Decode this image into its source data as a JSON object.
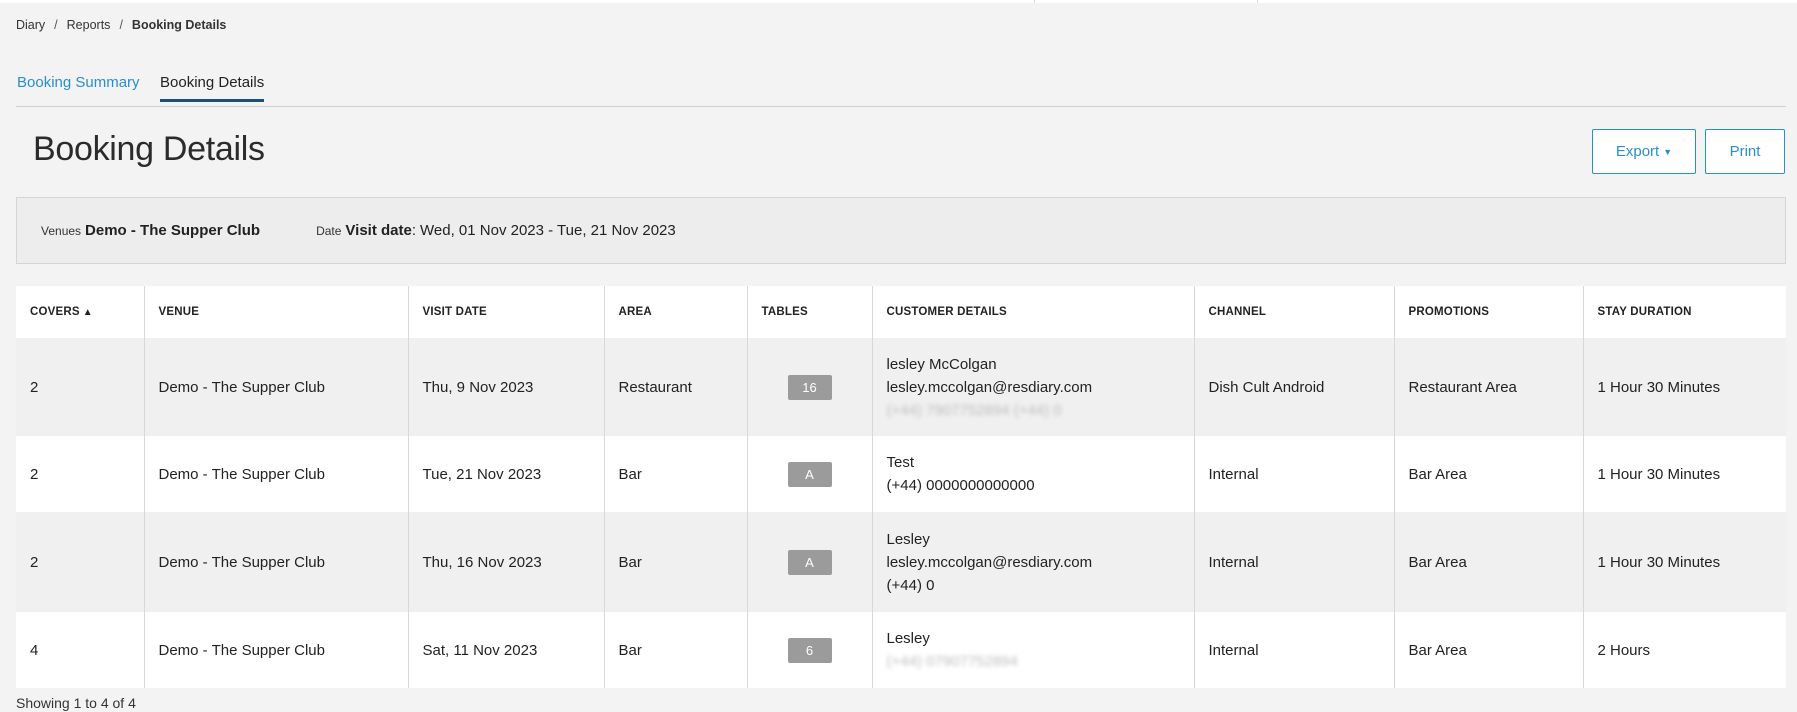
{
  "breadcrumb": {
    "items": [
      "Diary",
      "Reports"
    ],
    "current": "Booking Details",
    "separator": "/"
  },
  "tabs": [
    {
      "label": "Booking Summary",
      "active": false
    },
    {
      "label": "Booking Details",
      "active": true
    }
  ],
  "page": {
    "title": "Booking Details"
  },
  "actions": {
    "export_label": "Export",
    "print_label": "Print"
  },
  "filters": {
    "venues_label": "Venues",
    "venues_value": "Demo - The Supper Club",
    "date_label": "Date",
    "date_key": "Visit date",
    "date_value": "Wed, 01 Nov 2023 - Tue, 21 Nov 2023"
  },
  "table": {
    "columns": [
      "COVERS",
      "VENUE",
      "VISIT DATE",
      "AREA",
      "TABLES",
      "CUSTOMER DETAILS",
      "CHANNEL",
      "PROMOTIONS",
      "STAY DURATION"
    ],
    "sorted_column": "COVERS",
    "sort_direction": "ascending",
    "rows": [
      {
        "covers": "2",
        "venue": "Demo - The Supper Club",
        "visit_date": "Thu, 9 Nov 2023",
        "area": "Restaurant",
        "table": "16",
        "customer": {
          "name": "lesley McColgan",
          "email": "lesley.mccolgan@resdiary.com",
          "phone": "(+44) 7907752894 (+44) 0"
        },
        "channel": "Dish Cult Android",
        "promotions": "Restaurant Area",
        "stay_duration": "1 Hour 30 Minutes"
      },
      {
        "covers": "2",
        "venue": "Demo - The Supper Club",
        "visit_date": "Tue, 21 Nov 2023",
        "area": "Bar",
        "table": "A",
        "customer": {
          "name": "Test",
          "phone": "(+44) 0000000000000"
        },
        "channel": "Internal",
        "promotions": "Bar Area",
        "stay_duration": "1 Hour 30 Minutes"
      },
      {
        "covers": "2",
        "venue": "Demo - The Supper Club",
        "visit_date": "Thu, 16 Nov 2023",
        "area": "Bar",
        "table": "A",
        "customer": {
          "name": "Lesley",
          "email": "lesley.mccolgan@resdiary.com",
          "phone": "(+44) 0"
        },
        "channel": "Internal",
        "promotions": "Bar Area",
        "stay_duration": "1 Hour 30 Minutes"
      },
      {
        "covers": "4",
        "venue": "Demo - The Supper Club",
        "visit_date": "Sat, 11 Nov 2023",
        "area": "Bar",
        "table": "6",
        "customer": {
          "name": "Lesley",
          "phone": "(+44) 07907752894"
        },
        "channel": "Internal",
        "promotions": "Bar Area",
        "stay_duration": "2 Hours"
      }
    ]
  },
  "footer": {
    "showing_text": "Showing 1 to 4 of 4"
  },
  "colors": {
    "accent": "#2a8fc9",
    "active_tab_underline": "#1d4f7a",
    "badge": "#9b9b9b",
    "background": "#f3f3f3"
  },
  "icons": {
    "sort": "sort-ascending-icon",
    "export_caret": "caret-down-icon"
  }
}
